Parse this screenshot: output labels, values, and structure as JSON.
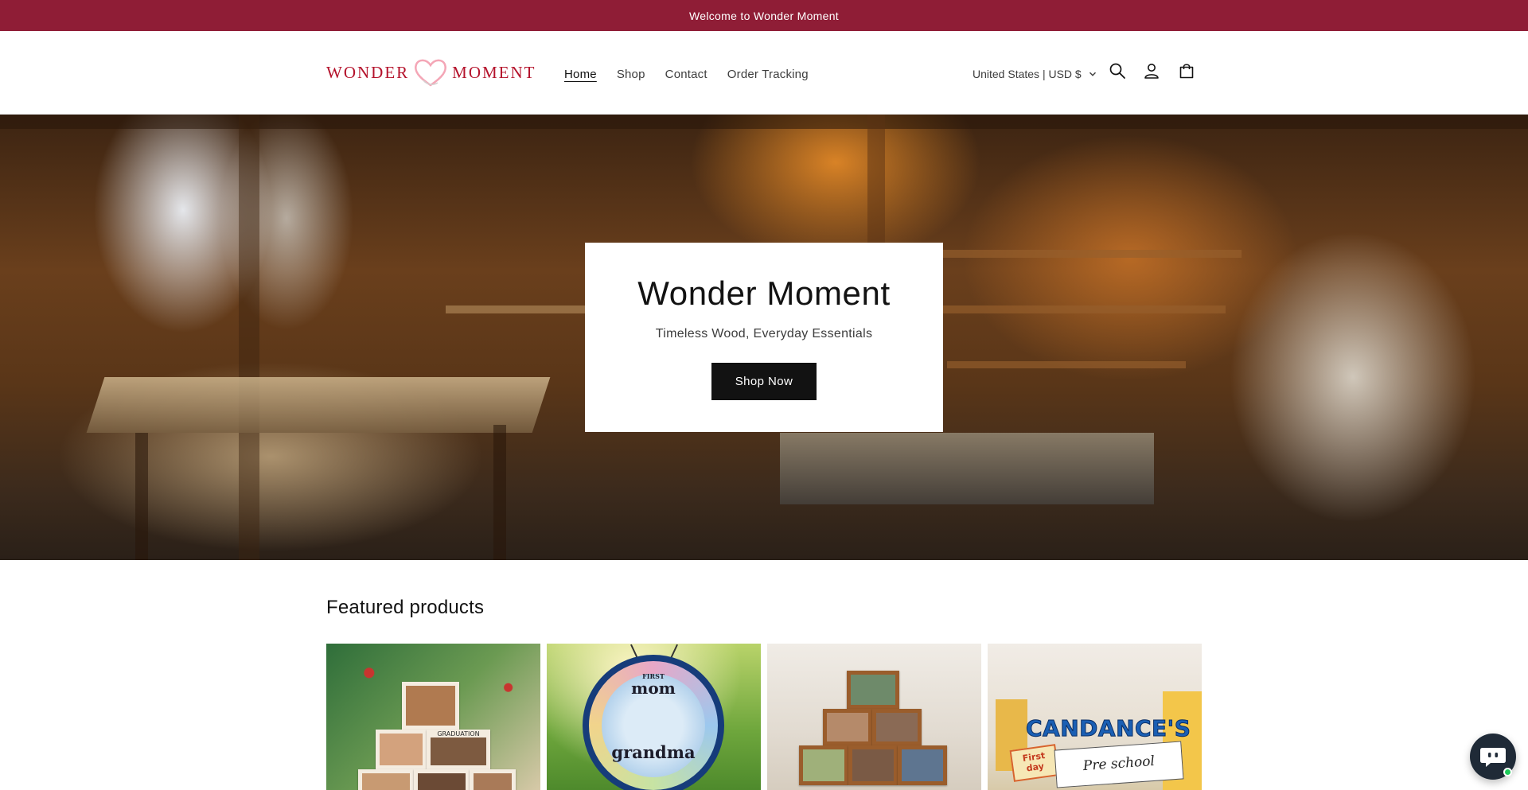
{
  "announcement": {
    "text": "Welcome to Wonder Moment"
  },
  "brand": {
    "logo_left": "WONDER",
    "logo_right": "MOMENT",
    "color": "#b4122b",
    "heart_color": "#f4a6b6"
  },
  "nav": {
    "items": [
      {
        "label": "Home",
        "active": true
      },
      {
        "label": "Shop",
        "active": false
      },
      {
        "label": "Contact",
        "active": false
      },
      {
        "label": "Order Tracking",
        "active": false
      }
    ]
  },
  "header": {
    "locale_label": "United States | USD $",
    "icons": [
      "search-icon",
      "account-icon",
      "cart-icon"
    ]
  },
  "hero": {
    "title": "Wonder Moment",
    "subtitle": "Timeless Wood, Everyday Essentials",
    "cta_label": "Shop Now"
  },
  "featured": {
    "title": "Featured products",
    "products": [
      {
        "name": "photo-frame-pyramid-christmas",
        "image_text": "GRADUATION"
      },
      {
        "name": "stained-glass-ornament",
        "image_text_top": "FIRST",
        "image_text_1": "mom",
        "image_text_2": "grandma"
      },
      {
        "name": "wood-photo-frame-pyramid",
        "image_text": ""
      },
      {
        "name": "first-day-sign",
        "image_text_1": "CANDANCE'S",
        "image_text_2": "Pre school",
        "image_text_3": "First day"
      }
    ]
  },
  "colors": {
    "announcement_bg": "#8f1d36",
    "button_bg": "#121212",
    "chat_bg": "#1f2a37",
    "online_dot": "#1ecb5a"
  },
  "chat": {
    "icon": "chat-bot-icon"
  }
}
